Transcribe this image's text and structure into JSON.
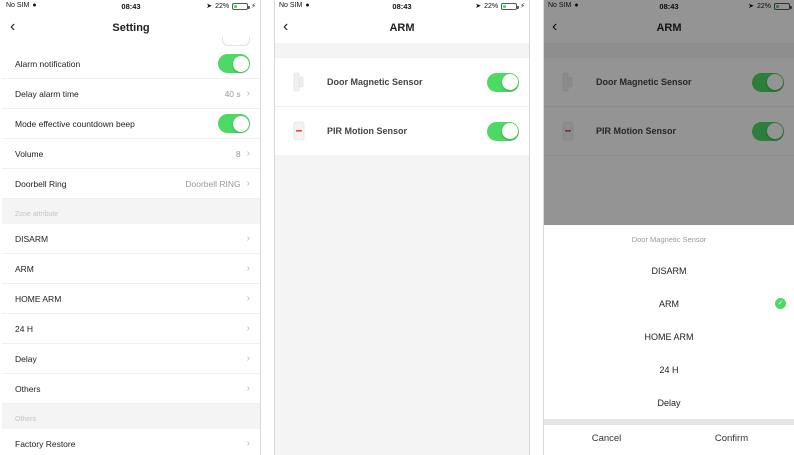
{
  "status": {
    "carrier": "No SIM",
    "time": "08:43",
    "battery": "22%",
    "battery_level": 0.22
  },
  "setting_screen": {
    "title": "Setting",
    "rows": [
      {
        "label": "Alarm notification",
        "kind": "toggle",
        "on": true
      },
      {
        "label": "Delay alarm time",
        "kind": "value",
        "value": "40 s"
      },
      {
        "label": "Mode effective countdown beep",
        "kind": "toggle",
        "on": true
      },
      {
        "label": "Volume",
        "kind": "value",
        "value": "8"
      },
      {
        "label": "Doorbell Ring",
        "kind": "value",
        "value": "Doorbell RING"
      }
    ],
    "zone_section": "Zone attribute",
    "zone_rows": [
      "DISARM",
      "ARM",
      "HOME ARM",
      "24 H",
      "Delay",
      "Others"
    ],
    "others_section": "Others",
    "others_rows": [
      "Factory Restore"
    ]
  },
  "arm_screen": {
    "title": "ARM",
    "sensors": [
      {
        "label": "Door Magnetic Sensor",
        "icon": "door-sensor-icon",
        "on": true
      },
      {
        "label": "PIR Motion Sensor",
        "icon": "pir-sensor-icon",
        "on": true
      }
    ]
  },
  "picker": {
    "title": "Door Magnetic Sensor",
    "options": [
      "DISARM",
      "ARM",
      "HOME ARM",
      "24 H",
      "Delay"
    ],
    "selected": "ARM",
    "cancel": "Cancel",
    "confirm": "Confirm"
  },
  "colors": {
    "toggle_on": "#4cd964",
    "section_bg": "#f4f4f4"
  }
}
